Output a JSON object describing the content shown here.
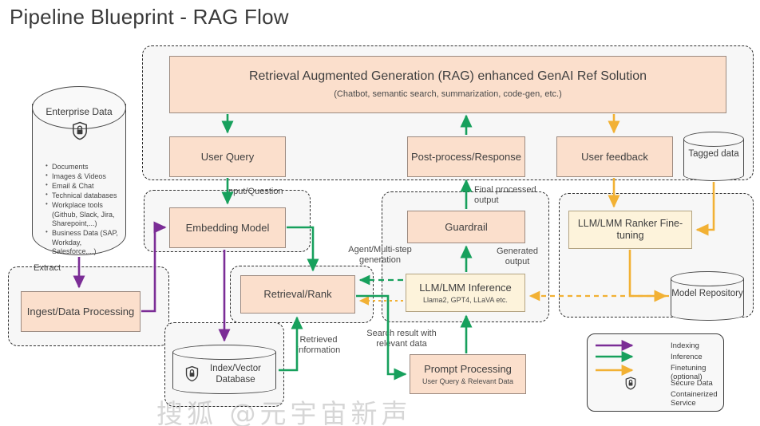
{
  "title": "Pipeline Blueprint - RAG Flow",
  "enterprise_data": {
    "name": "Enterprise Data",
    "icon": "lock-shield-icon",
    "items": [
      "Documents",
      "Images & Videos",
      "Email & Chat",
      "Technical databases",
      "Workplace tools (Github, Slack, Jira, Sharepoint,...)",
      "Business Data (SAP, Workday, Salesforce,...)"
    ]
  },
  "banner": {
    "title": "Retrieval Augmented Generation (RAG) enhanced GenAI Ref Solution",
    "subtitle": "(Chatbot, semantic search, summarization, code-gen, etc.)"
  },
  "nodes": {
    "user_query": "User Query",
    "post_process": "Post-process/Response",
    "user_feedback": "User feedback",
    "tagged_data": "Tagged data",
    "embedding_model": "Embedding Model",
    "guardrail": "Guardrail",
    "ranker_finetuning": "LLM/LMM Ranker Fine-tuning",
    "ingest": "Ingest/Data Processing",
    "retrieval_rank": "Retrieval/Rank",
    "llm_inference": "LLM/LMM Inference",
    "llm_inference_sub": "Llama2, GPT4, LLaVA etc.",
    "model_repository": "Model Repository",
    "index_vector_db": "Index/Vector Database",
    "prompt_processing": "Prompt Processing",
    "prompt_processing_sub": "User Query & Relevant Data"
  },
  "edge_labels": {
    "input_question": "Input/Question",
    "final_processed_output": "Final processed output",
    "agent_multistep": "Agent/Multi-step generation",
    "generated_output": "Generated output",
    "extract": "Extract",
    "retrieved_information": "Retrieved information",
    "search_result": "Search result with relevant data"
  },
  "legend": {
    "entries": [
      {
        "label": "Indexing",
        "kind": "arrow",
        "color": "#7b2d96"
      },
      {
        "label": "Inference",
        "kind": "arrow",
        "color": "#1aa05a"
      },
      {
        "label": "Finetuning (optional)",
        "kind": "arrow",
        "color": "#f2b134"
      },
      {
        "label": "Secure Data",
        "kind": "icon",
        "icon": "lock-shield-icon"
      },
      {
        "label": "Containerized Service",
        "kind": "text"
      }
    ]
  },
  "colors": {
    "indexing": "#7b2d96",
    "inference": "#17a05c",
    "finetuning": "#f2b134",
    "box_fill": "#fbdfcc",
    "box_fill_yellow": "#fdf3db",
    "group_bg": "#f7f7f7"
  },
  "watermark": "搜狐 @元宇宙新声"
}
